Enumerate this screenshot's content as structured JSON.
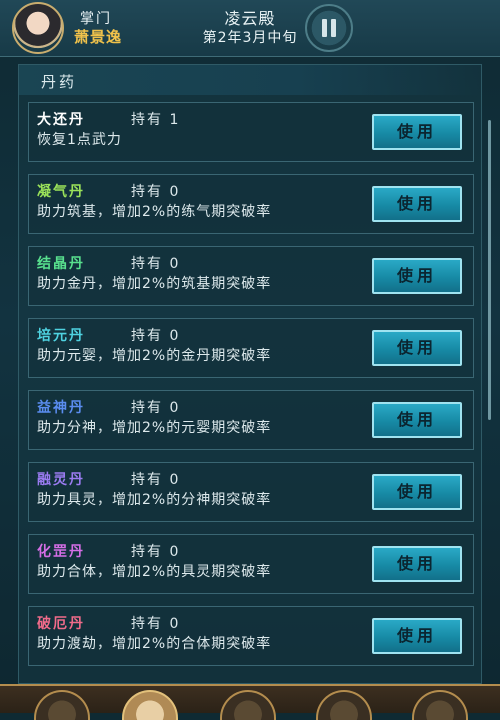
{
  "header": {
    "role": "掌门",
    "player_name": "萧景逸",
    "location": "凌云殿",
    "date": "第2年3月中旬"
  },
  "section_title": "丹药",
  "items": [
    {
      "name": "大还丹",
      "hold": "持有 1",
      "desc": "恢复1点武力",
      "color": "#ffffff",
      "button": "使用"
    },
    {
      "name": "凝气丹",
      "hold": "持有 0",
      "desc": "助力筑基，增加2%的练气期突破率",
      "color": "#9be35a",
      "button": "使用"
    },
    {
      "name": "结晶丹",
      "hold": "持有 0",
      "desc": "助力金丹，增加2%的筑基期突破率",
      "color": "#58e08e",
      "button": "使用"
    },
    {
      "name": "培元丹",
      "hold": "持有 0",
      "desc": "助力元婴，增加2%的金丹期突破率",
      "color": "#4fd2e0",
      "button": "使用"
    },
    {
      "name": "益神丹",
      "hold": "持有 0",
      "desc": "助力分神，增加2%的元婴期突破率",
      "color": "#5b8df0",
      "button": "使用"
    },
    {
      "name": "融灵丹",
      "hold": "持有 0",
      "desc": "助力具灵，增加2%的分神期突破率",
      "color": "#9a7bf0",
      "button": "使用"
    },
    {
      "name": "化罡丹",
      "hold": "持有 0",
      "desc": "助力合体，增加2%的具灵期突破率",
      "color": "#d56ee6",
      "button": "使用"
    },
    {
      "name": "破厄丹",
      "hold": "持有 0",
      "desc": "助力渡劫，增加2%的合体期突破率",
      "color": "#f06b8a",
      "button": "使用"
    }
  ]
}
